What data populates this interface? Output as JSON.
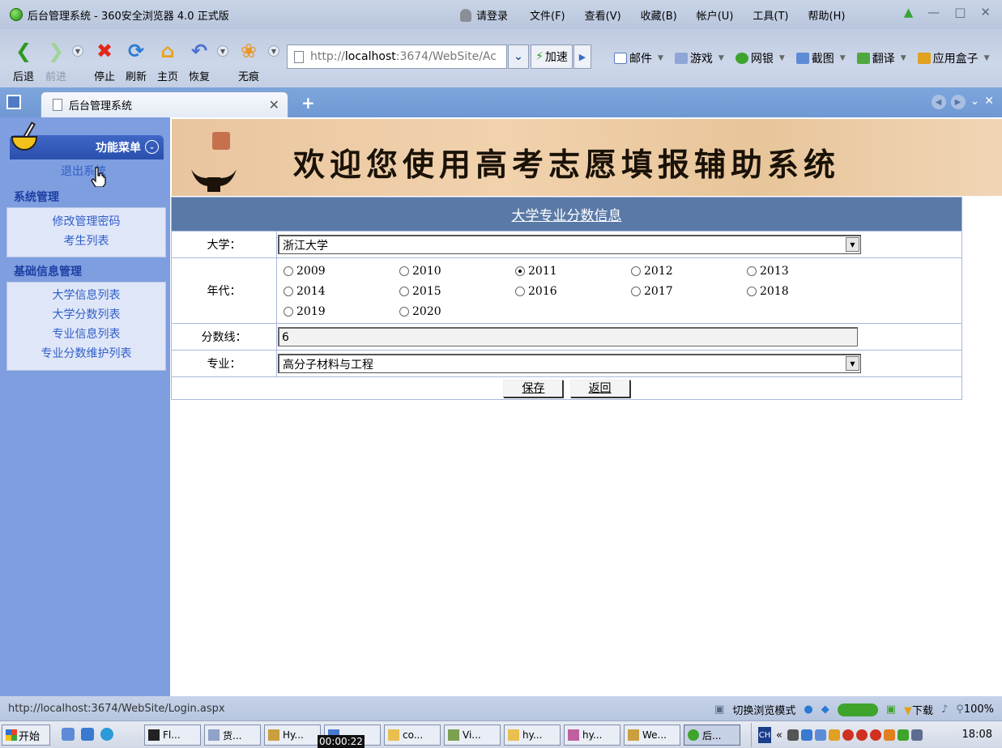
{
  "window": {
    "title": "后台管理系统 - 360安全浏览器 4.0 正式版",
    "login": "请登录",
    "menu": [
      "文件(F)",
      "查看(V)",
      "收藏(B)",
      "帐户(U)",
      "工具(T)",
      "帮助(H)"
    ]
  },
  "toolbar": {
    "back": "后退",
    "forward": "前进",
    "stop": "停止",
    "refresh": "刷新",
    "home": "主页",
    "restore": "恢复",
    "incognito": "无痕",
    "address_prefix": "http://",
    "address_host": "localhost",
    "address_rest": ":3674/WebSite/Ac",
    "accelerate": "加速",
    "tools": [
      "邮件",
      "游戏",
      "网银",
      "截图",
      "翻译",
      "应用盒子"
    ]
  },
  "tab": {
    "title": "后台管理系统"
  },
  "sidebar": {
    "header": "功能菜单",
    "logout": "退出系统",
    "sections": [
      {
        "title": "系统管理",
        "items": [
          "修改管理密码",
          "考生列表"
        ]
      },
      {
        "title": "基础信息管理",
        "items": [
          "大学信息列表",
          "大学分数列表",
          "专业信息列表",
          "专业分数维护列表"
        ]
      }
    ]
  },
  "banner": {
    "title": "欢迎您使用高考志愿填报辅助系统"
  },
  "form": {
    "heading": "大学专业分数信息",
    "university_label": "大学：",
    "university_value": "浙江大学",
    "year_label": "年代：",
    "years": [
      "2009",
      "2010",
      "2011",
      "2012",
      "2013",
      "2014",
      "2015",
      "2016",
      "2017",
      "2018",
      "2019",
      "2020"
    ],
    "selected_year": "2011",
    "score_label": "分数线：",
    "score_value": "6",
    "major_label": "专业：",
    "major_value": "高分子材料与工程",
    "save": "保存",
    "back": "返回"
  },
  "statusbar": {
    "url": "http://localhost:3674/WebSite/Login.aspx",
    "switch_mode": "切换浏览模式",
    "download": "下载",
    "zoom": "100%"
  },
  "taskbar": {
    "start": "开始",
    "tasks": [
      "Fl...",
      "货...",
      "Hy...",
      "...",
      "co...",
      "Vi...",
      "hy...",
      "hy...",
      "We...",
      "后..."
    ],
    "recording_time": "00:00:22",
    "ime": "CH",
    "clock": "18:08"
  },
  "colors": {
    "sidebar_bg": "#7e9ee0",
    "form_header_bg": "#5a79a6",
    "tab_bar_bg": "#7ea6dd",
    "link": "#2f5ec9"
  }
}
